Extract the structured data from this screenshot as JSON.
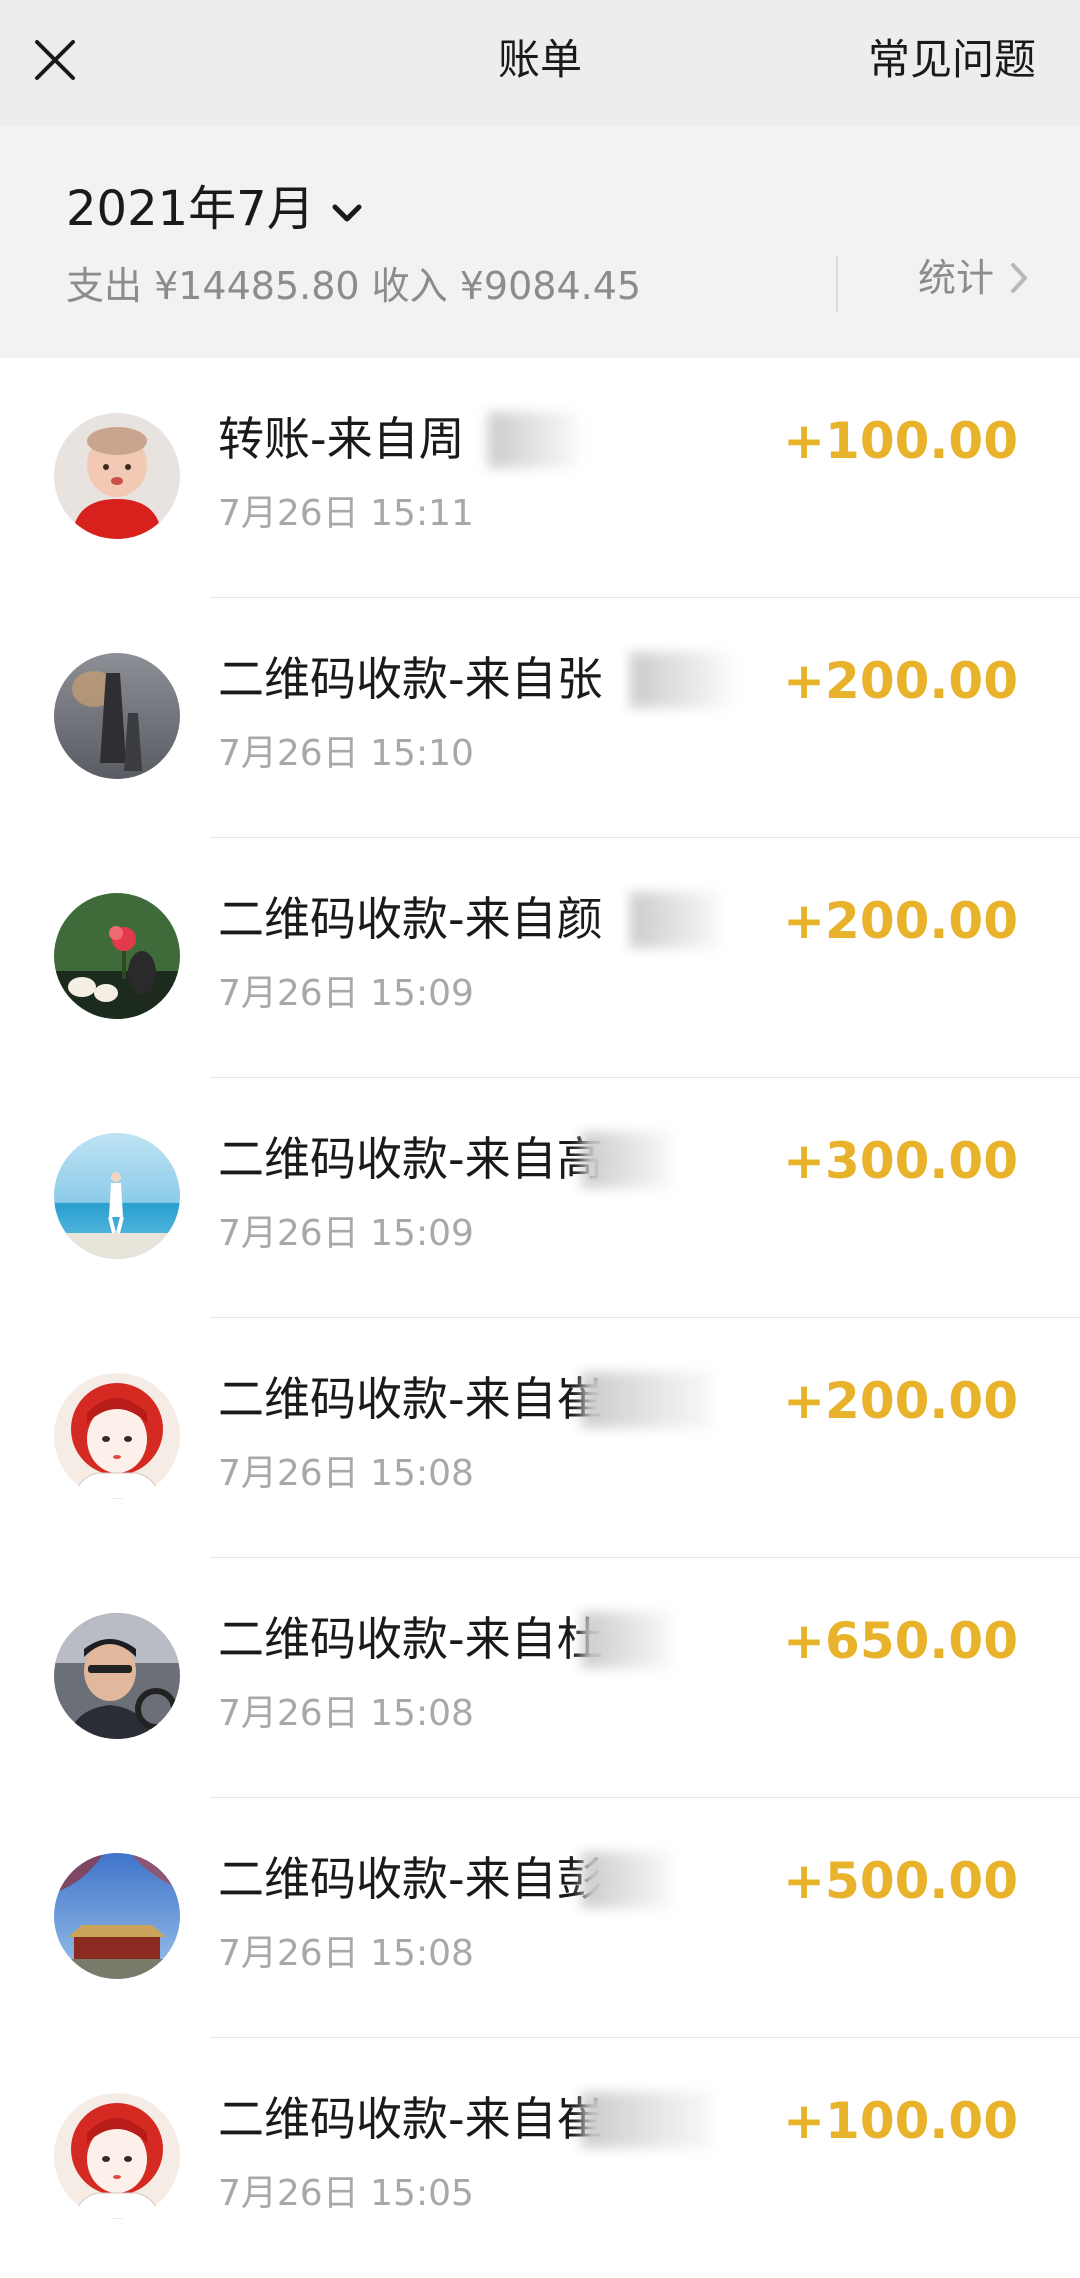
{
  "topbar": {
    "title": "账单",
    "faq_label": "常见问题"
  },
  "month": {
    "label": "2021年7月",
    "summary": "支出 ¥14485.80 收入 ¥9084.45",
    "stats_label": "统计"
  },
  "colors": {
    "amount": "#e8b22a",
    "topbar_bg": "#ededed",
    "header_bg": "#f2f2f2"
  },
  "transactions": [
    {
      "title": "转账-来自周",
      "time": "7月26日 15:11",
      "amount": "+100.00",
      "avatar": "baby-photo-avatar"
    },
    {
      "title": "二维码收款-来自张",
      "time": "7月26日 15:10",
      "amount": "+200.00",
      "avatar": "shadow-photo-avatar"
    },
    {
      "title": "二维码收款-来自颜",
      "time": "7月26日 15:09",
      "amount": "+200.00",
      "avatar": "tea-flower-avatar"
    },
    {
      "title": "二维码收款-来自高",
      "time": "7月26日 15:09",
      "amount": "+300.00",
      "avatar": "beach-avatar"
    },
    {
      "title": "二维码收款-来自崔",
      "time": "7月26日 15:08",
      "amount": "+200.00",
      "avatar": "cartoon-girl-avatar"
    },
    {
      "title": "二维码收款-来自杜",
      "time": "7月26日 15:08",
      "amount": "+650.00",
      "avatar": "man-in-car-avatar"
    },
    {
      "title": "二维码收款-来自彭",
      "time": "7月26日 15:08",
      "amount": "+500.00",
      "avatar": "palace-avatar"
    },
    {
      "title": "二维码收款-来自崔",
      "time": "7月26日 15:05",
      "amount": "+100.00",
      "avatar": "cartoon-girl-avatar"
    }
  ]
}
